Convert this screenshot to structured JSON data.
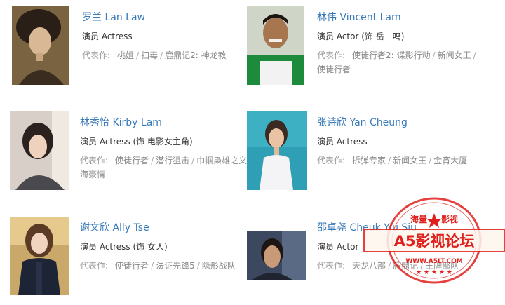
{
  "cast": [
    {
      "name": "罗兰 Lan Law",
      "role": "演员 Actress",
      "works_label": "代表作:",
      "works": [
        "桃姐",
        "扫毒",
        "鹿鼎记2: 神龙教"
      ]
    },
    {
      "name": "林伟 Vincent Lam",
      "role": "演员 Actor (饰 岳一鸣)",
      "works_label": "代表作:",
      "works": [
        "使徒行者2: 谍影行动",
        "新闻女王",
        "使徒行者"
      ]
    },
    {
      "name": "林秀怡 Kirby Lam",
      "role": "演员 Actress (饰 电影女主角)",
      "works_label": "代表作:",
      "works": [
        "使徒行者",
        "潜行狙击",
        "巾帼枭雄之义海豪情"
      ]
    },
    {
      "name": "张诗欣 Yan Cheung",
      "role": "演员 Actress",
      "works_label": "代表作:",
      "works": [
        "拆弹专家",
        "新闻女王",
        "金宵大厦"
      ]
    },
    {
      "name": "谢文欣 Ally Tse",
      "role": "演员 Actress (饰 女人)",
      "works_label": "代表作:",
      "works": [
        "使徒行者",
        "法证先锋5",
        "隐形战队"
      ]
    },
    {
      "name": "邵卓尧 Cheuk Yiu Siu",
      "role": "演员 Actor",
      "works_label": "代表作:",
      "works": [
        "天龙八部",
        "鹿鼎记",
        "王牌部队"
      ]
    }
  ],
  "watermark": {
    "top_left": "海量",
    "top_right": "影视",
    "title": "A5影视论坛",
    "url": "WWW.A5LT.COM",
    "color": "#e0201c"
  }
}
